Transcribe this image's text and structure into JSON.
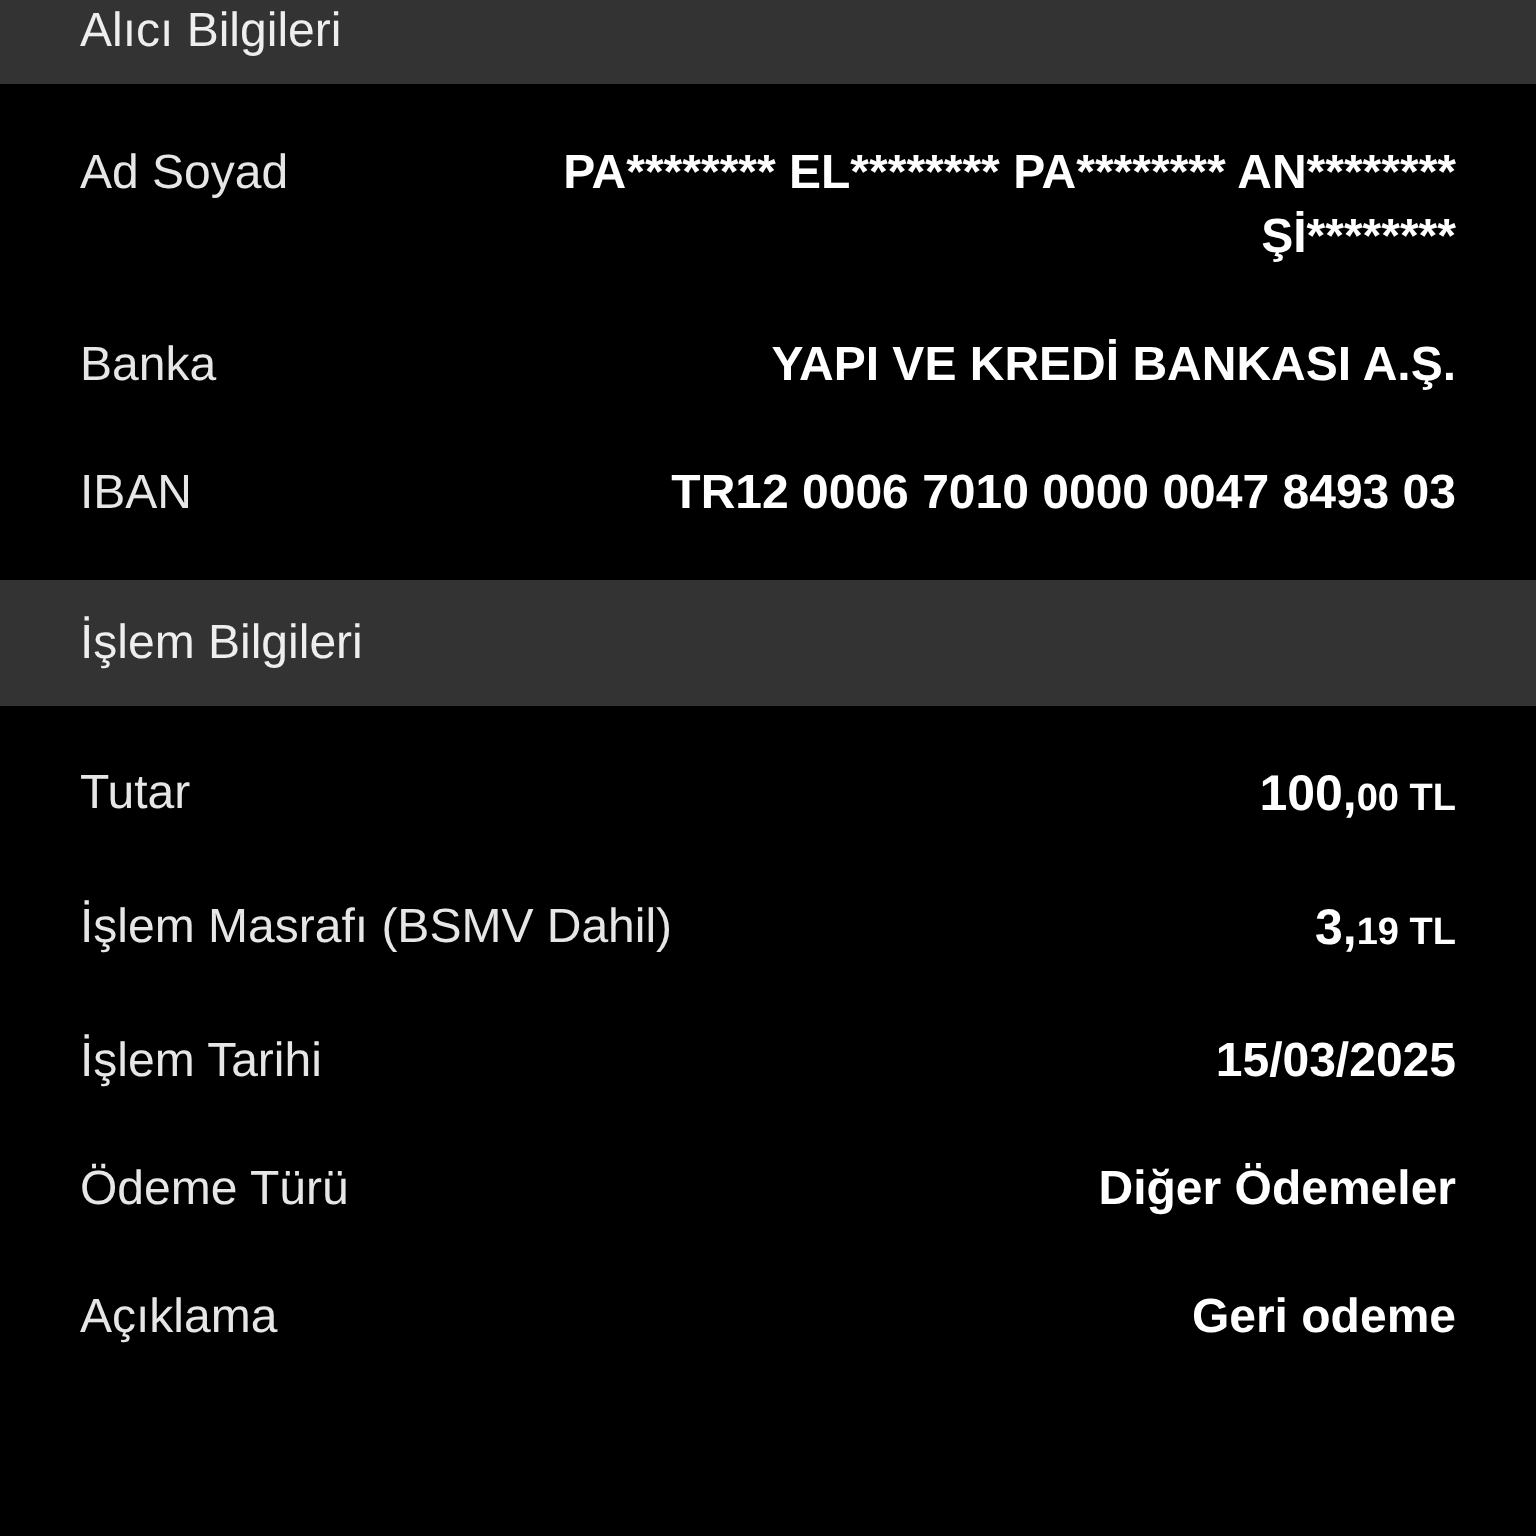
{
  "sections": [
    {
      "title": "Alıcı Bilgileri",
      "rows": [
        {
          "kind": "text",
          "label": "Ad Soyad",
          "value": "PA******** EL******** PA******** AN******** Şİ********"
        },
        {
          "kind": "text",
          "label": "Banka",
          "value": "YAPI VE KREDİ BANKASI A.Ş."
        },
        {
          "kind": "text",
          "label": "IBAN",
          "value": "TR12 0006 7010 0000 0047 8493 03"
        }
      ]
    },
    {
      "title": "İşlem Bilgileri",
      "rows": [
        {
          "kind": "amount",
          "label": "Tutar",
          "value": {
            "main": "100,",
            "minor": "00",
            "currency": "TL"
          }
        },
        {
          "kind": "amount",
          "label": "İşlem Masrafı (BSMV Dahil)",
          "value": {
            "main": "3,",
            "minor": "19",
            "currency": "TL"
          }
        },
        {
          "kind": "text",
          "label": "İşlem Tarihi",
          "value": "15/03/2025"
        },
        {
          "kind": "text",
          "label": "Ödeme Türü",
          "value": "Diğer Ödemeler"
        },
        {
          "kind": "text",
          "label": "Açıklama",
          "value": "Geri odeme"
        }
      ]
    }
  ]
}
